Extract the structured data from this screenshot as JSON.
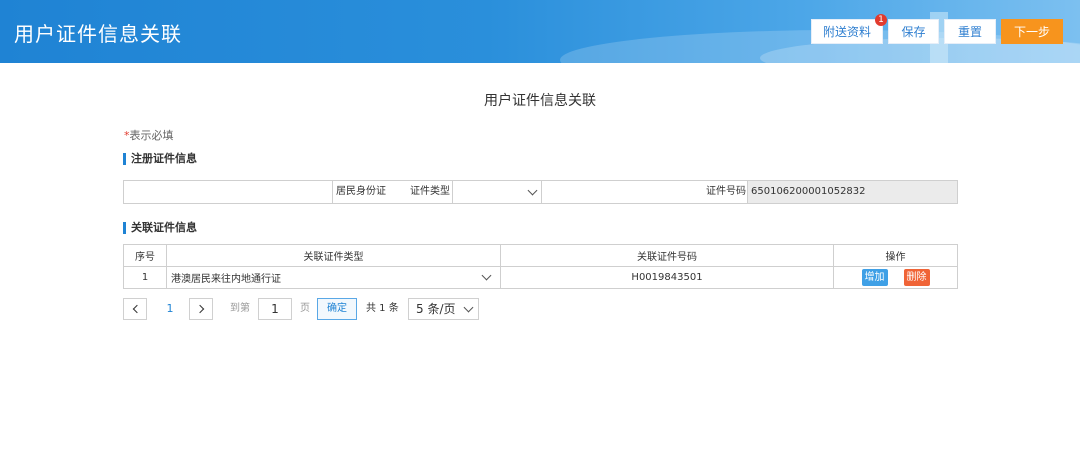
{
  "header": {
    "title": "用户证件信息关联",
    "buttons": {
      "attach": "附送资料",
      "attach_badge": "1",
      "save": "保存",
      "reset": "重置",
      "next": "下一步"
    }
  },
  "page_title": "用户证件信息关联",
  "required_note": {
    "star": "*",
    "text": "表示必填"
  },
  "registration": {
    "section_title": "注册证件信息",
    "type_label": "证件类型",
    "type_value": "居民身份证",
    "number_label": "证件号码",
    "number_value": "650106200001052832"
  },
  "related": {
    "section_title": "关联证件信息",
    "columns": [
      "序号",
      "关联证件类型",
      "关联证件号码",
      "操作"
    ],
    "rows": [
      {
        "index": "1",
        "type": "港澳居民来往内地通行证",
        "number": "H0019843501",
        "add": "增加",
        "delete": "删除"
      }
    ]
  },
  "pagination": {
    "current_page": "1",
    "goto_label": "到第",
    "goto_value": "1",
    "page_unit": "页",
    "confirm": "确定",
    "total": "共 1 条",
    "page_size": "5 条/页"
  },
  "colors": {
    "header_blue": "#1f83d4",
    "next_orange": "#f7941d",
    "add_blue": "#3fa0e6",
    "delete_red": "#f06437",
    "badge_red": "#e23b2e"
  }
}
